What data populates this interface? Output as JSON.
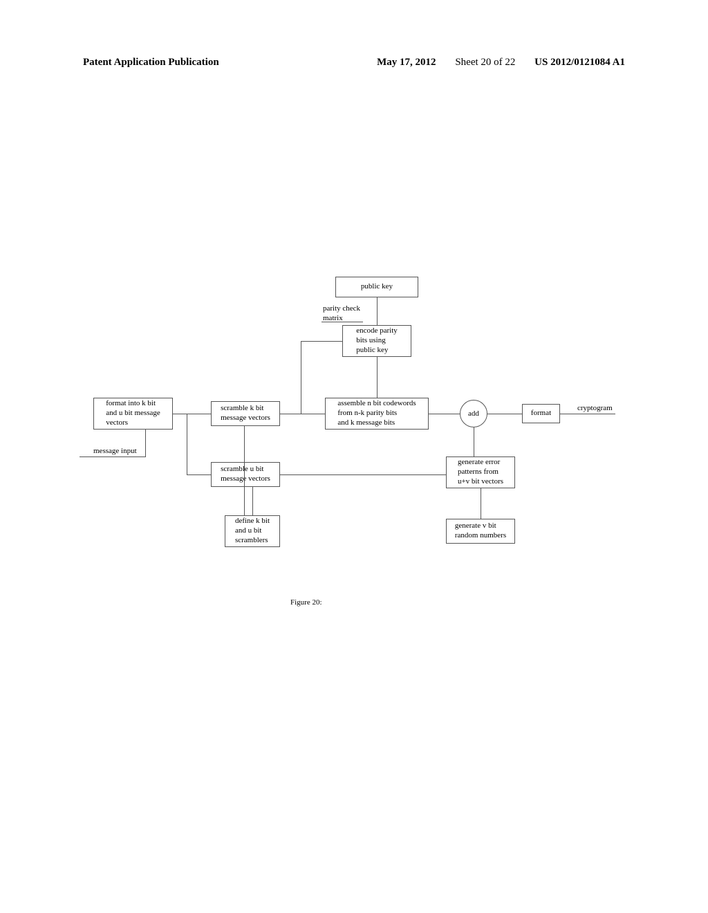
{
  "header": {
    "left": "Patent Application Publication",
    "date": "May 17, 2012",
    "sheet": "Sheet 20 of 22",
    "pubno": "US 2012/0121084 A1"
  },
  "labels": {
    "message_input": "message input",
    "parity_check": "parity check\nmatrix",
    "cryptogram": "cryptogram"
  },
  "boxes": {
    "public_key": "public key",
    "encode_parity": "encode parity\nbits using\npublic key",
    "format_kbit": "format into k bit\nand u bit message\nvectors",
    "scramble_k": "scramble k bit\nmessage vectors",
    "assemble": "assemble n bit codewords\nfrom n-k  parity bits\nand k message bits",
    "add": "add",
    "format_crypt": "format",
    "scramble_u": "scramble u bit\nmessage vectors",
    "gen_err": "generate error\npatterns from\nu+v bit vectors",
    "define_scr": "define k bit\nand u bit\nscramblers",
    "gen_vbit": "generate v bit\nrandom numbers"
  },
  "caption": "Figure 20:"
}
